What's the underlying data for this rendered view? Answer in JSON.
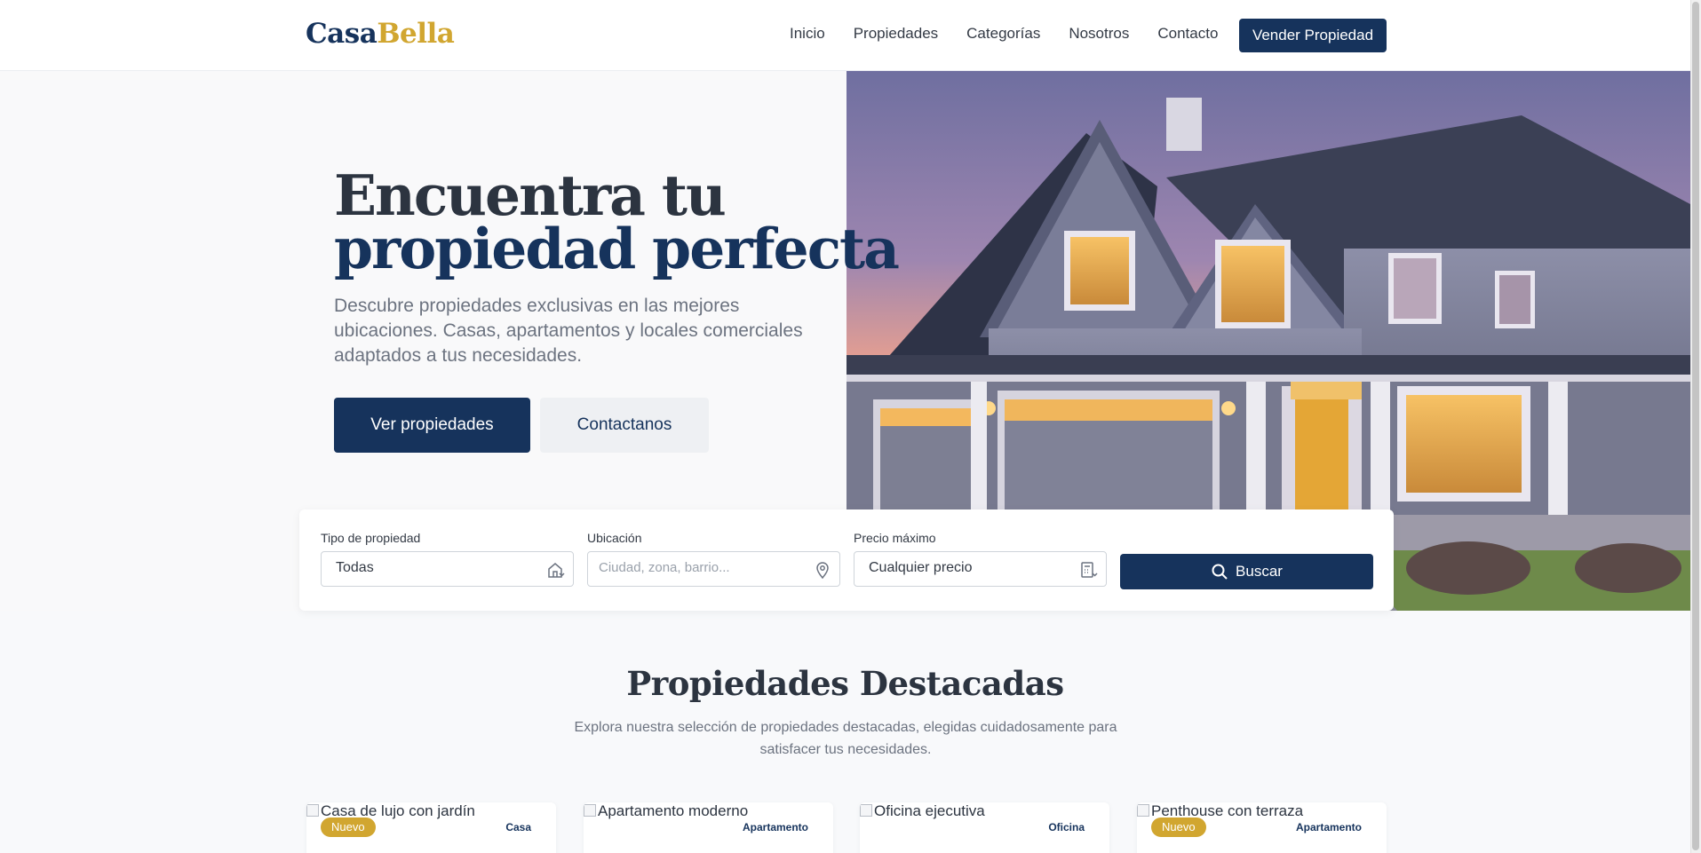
{
  "header": {
    "logo_part1": "Casa",
    "logo_part2": "Bella",
    "nav": [
      "Inicio",
      "Propiedades",
      "Categorías",
      "Nosotros",
      "Contacto"
    ],
    "cta": "Vender Propiedad"
  },
  "hero": {
    "title_line1": "Encuentra tu",
    "title_line2": "propiedad perfecta",
    "subtitle": "Descubre propiedades exclusivas en las mejores ubicaciones. Casas, apartamentos y locales comerciales adaptados a tus necesidades.",
    "primary_button": "Ver propiedades",
    "secondary_button": "Contactanos"
  },
  "search": {
    "type_label": "Tipo de propiedad",
    "type_value": "Todas",
    "location_label": "Ubicación",
    "location_placeholder": "Ciudad, zona, barrio...",
    "price_label": "Precio máximo",
    "price_value": "Cualquier precio",
    "button": "Buscar"
  },
  "featured": {
    "title": "Propiedades Destacadas",
    "subtitle": "Explora nuestra selección de propiedades destacadas, elegidas cuidadosamente para satisfacer tus necesidades.",
    "cards": [
      {
        "alt": "Casa de lujo con jardín",
        "badge": "Nuevo",
        "type": "Casa"
      },
      {
        "alt": "Apartamento moderno",
        "badge": "",
        "type": "Apartamento"
      },
      {
        "alt": "Oficina ejecutiva",
        "badge": "",
        "type": "Oficina"
      },
      {
        "alt": "Penthouse con terraza",
        "badge": "Nuevo",
        "type": "Apartamento"
      }
    ]
  },
  "colors": {
    "primary": "#16335c",
    "accent": "#d1a630",
    "text": "#2c3440",
    "muted": "#6c7380",
    "background": "#f8f9fb"
  },
  "icons": {
    "type_field": "house-dropdown-icon",
    "location_field": "map-pin-icon",
    "price_field": "calculator-dropdown-icon",
    "search_button": "search-icon"
  }
}
